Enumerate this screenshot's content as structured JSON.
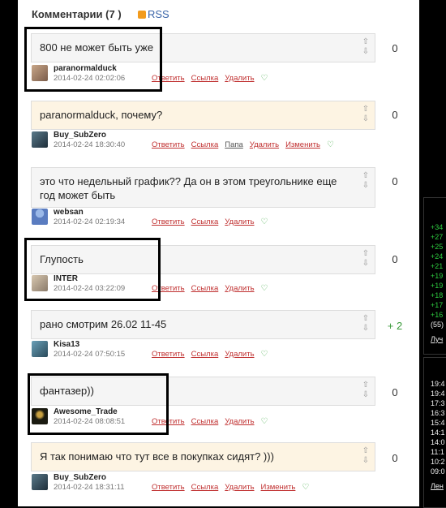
{
  "header": {
    "title": "Комментарии (7 )",
    "rss": "RSS"
  },
  "comments": [
    {
      "text": "800 не может быть уже",
      "author": "paranormalduck",
      "date": "2014-02-24 02:02:06",
      "actions": [
        "Ответить",
        "Ссылка",
        "Удалить"
      ],
      "score": "0"
    },
    {
      "text": "paranormalduck, почему?",
      "author": "Buy_SubZero",
      "date": "2014-02-24 18:30:40",
      "actions": [
        "Ответить",
        "Ссылка",
        "Папа",
        "Удалить",
        "Изменить"
      ],
      "score": "0"
    },
    {
      "text": "это что недельный график?? Да он в этом треугольнике еще год может быть",
      "author": "websan",
      "date": "2014-02-24 02:19:34",
      "actions": [
        "Ответить",
        "Ссылка",
        "Удалить"
      ],
      "score": "0"
    },
    {
      "text": "Глупость",
      "author": "INTER",
      "date": "2014-02-24 03:22:09",
      "actions": [
        "Ответить",
        "Ссылка",
        "Удалить"
      ],
      "score": "0"
    },
    {
      "text": "рано смотрим 26.02 11-45",
      "author": "Kisa13",
      "date": "2014-02-24 07:50:15",
      "actions": [
        "Ответить",
        "Ссылка",
        "Удалить"
      ],
      "score": "+ 2"
    },
    {
      "text": "фантазер))",
      "author": "Awesome_Trade",
      "date": "2014-02-24 08:08:51",
      "actions": [
        "Ответить",
        "Ссылка",
        "Удалить"
      ],
      "score": "0"
    },
    {
      "text": "Я так понимаю что тут все в покупках сидят? )))",
      "author": "Buy_SubZero",
      "date": "2014-02-24 18:31:11",
      "actions": [
        "Ответить",
        "Ссылка",
        "Удалить",
        "Изменить"
      ],
      "score": "0"
    }
  ],
  "side1": [
    "+34",
    "+27",
    "+25",
    "+24",
    "+21",
    "+19",
    "+19",
    "+18",
    "+17",
    "+16",
    "(55)",
    "Луч"
  ],
  "side2": [
    "19:4",
    "19:4",
    "17:3",
    "16:3",
    "15:4",
    "14:1",
    "14:0",
    "11:1",
    "10:2",
    "09:0",
    "Лен"
  ],
  "colors": {
    "link": "#c03030",
    "positive": "#2ecc40",
    "highlight": "#fdf4e3"
  }
}
